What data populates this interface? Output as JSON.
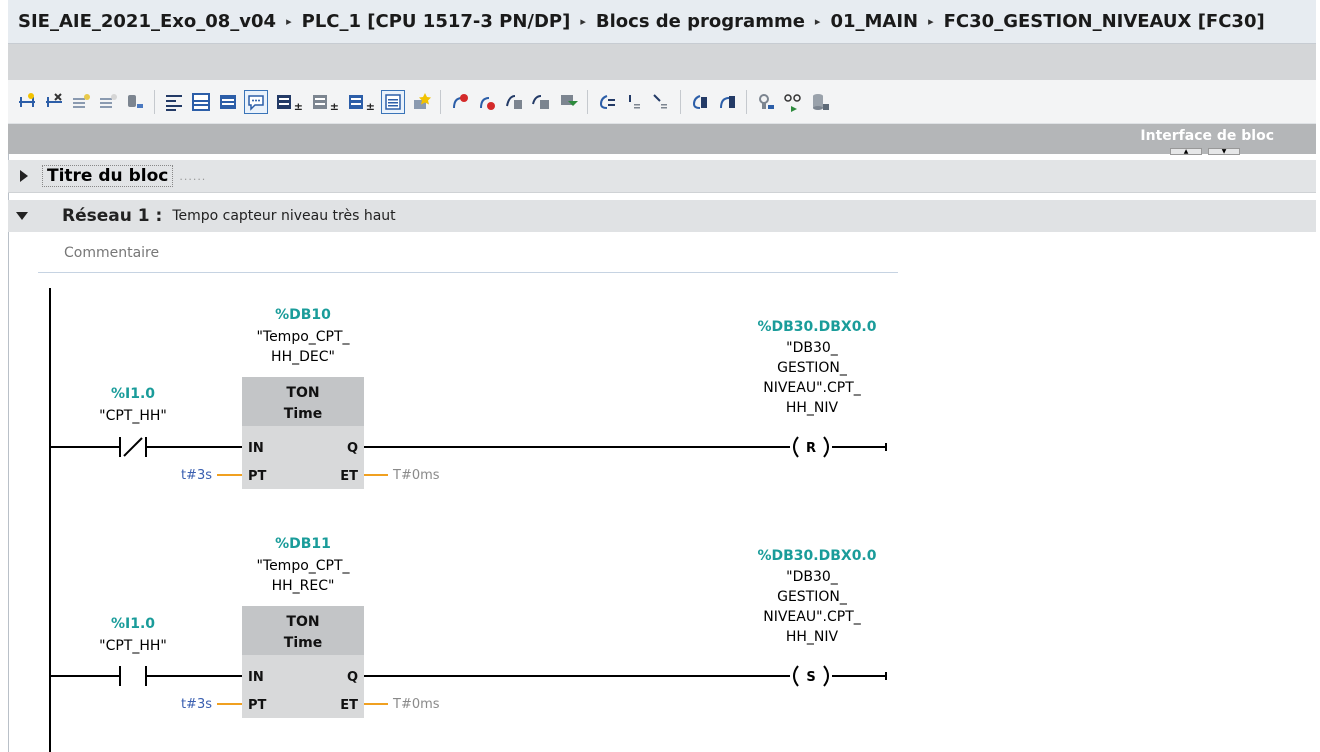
{
  "breadcrumb": {
    "project": "SIE_AIE_2021_Exo_08_v04",
    "device": "PLC_1 [CPU 1517-3 PN/DP]",
    "folder": "Blocs de programme",
    "group": "01_MAIN",
    "block": "FC30_GESTION_NIVEAUX [FC30]",
    "separator": "▸"
  },
  "interface_panel": {
    "label": "Interface de bloc"
  },
  "block_title": {
    "label": "Titre du bloc",
    "dots": "......"
  },
  "network1": {
    "number": "Réseau 1 :",
    "description": "Tempo capteur niveau très haut",
    "comment_placeholder": "Commentaire"
  },
  "rungs": [
    {
      "contact_address": "%I1.0",
      "contact_tag": "\"CPT_HH\"",
      "contact_type": "normally-closed",
      "timer_db": "%DB10",
      "timer_name_l1": "\"Tempo_CPT_",
      "timer_name_l2": "HH_DEC\"",
      "timer_type": "TON",
      "timer_subtype": "Time",
      "pin_in": "IN",
      "pin_pt": "PT",
      "pin_q": "Q",
      "pin_et": "ET",
      "pt_value": "t#3s",
      "et_value": "T#0ms",
      "coil_address": "%DB30.DBX0.0",
      "coil_l1": "\"DB30_",
      "coil_l2": "GESTION_",
      "coil_l3": "NIVEAU\".CPT_",
      "coil_l4": "HH_NIV",
      "coil_op": "R"
    },
    {
      "contact_address": "%I1.0",
      "contact_tag": "\"CPT_HH\"",
      "contact_type": "normally-open",
      "timer_db": "%DB11",
      "timer_name_l1": "\"Tempo_CPT_",
      "timer_name_l2": "HH_REC\"",
      "timer_type": "TON",
      "timer_subtype": "Time",
      "pin_in": "IN",
      "pin_pt": "PT",
      "pin_q": "Q",
      "pin_et": "ET",
      "pt_value": "t#3s",
      "et_value": "T#0ms",
      "coil_address": "%DB30.DBX0.0",
      "coil_l1": "\"DB30_",
      "coil_l2": "GESTION_",
      "coil_l3": "NIVEAU\".CPT_",
      "coil_l4": "HH_NIV",
      "coil_op": "S"
    }
  ],
  "colors": {
    "address_teal": "#1a9c9a",
    "param_blue": "#3a5fb0",
    "wire_orange": "#f0a020",
    "box_fill": "#d8d9da",
    "box_header": "#c3c5c7",
    "et_gray": "#8a8a8a"
  },
  "toolbar_icons": [
    "insert-network-icon",
    "delete-network-icon",
    "insert-row-icon",
    "append-row-icon",
    "address-icon",
    "absolute-display-icon",
    "symbolic-display-icon",
    "symbol-address-icon",
    "comments-toggle-icon",
    "open-all-networks-icon",
    "close-all-networks-icon",
    "navigate-icon",
    "favorites-bar-icon",
    "favorites-star-icon",
    "go-to-error-icon",
    "prev-error-icon",
    "next-error-icon",
    "monitor-icon",
    "download-icon",
    "call-hierarchy-icon",
    "jump-icon",
    "jump-return-icon",
    "open-block-icon",
    "return-block-icon",
    "watch-icon",
    "monitoring-glasses-icon",
    "database-icon"
  ]
}
